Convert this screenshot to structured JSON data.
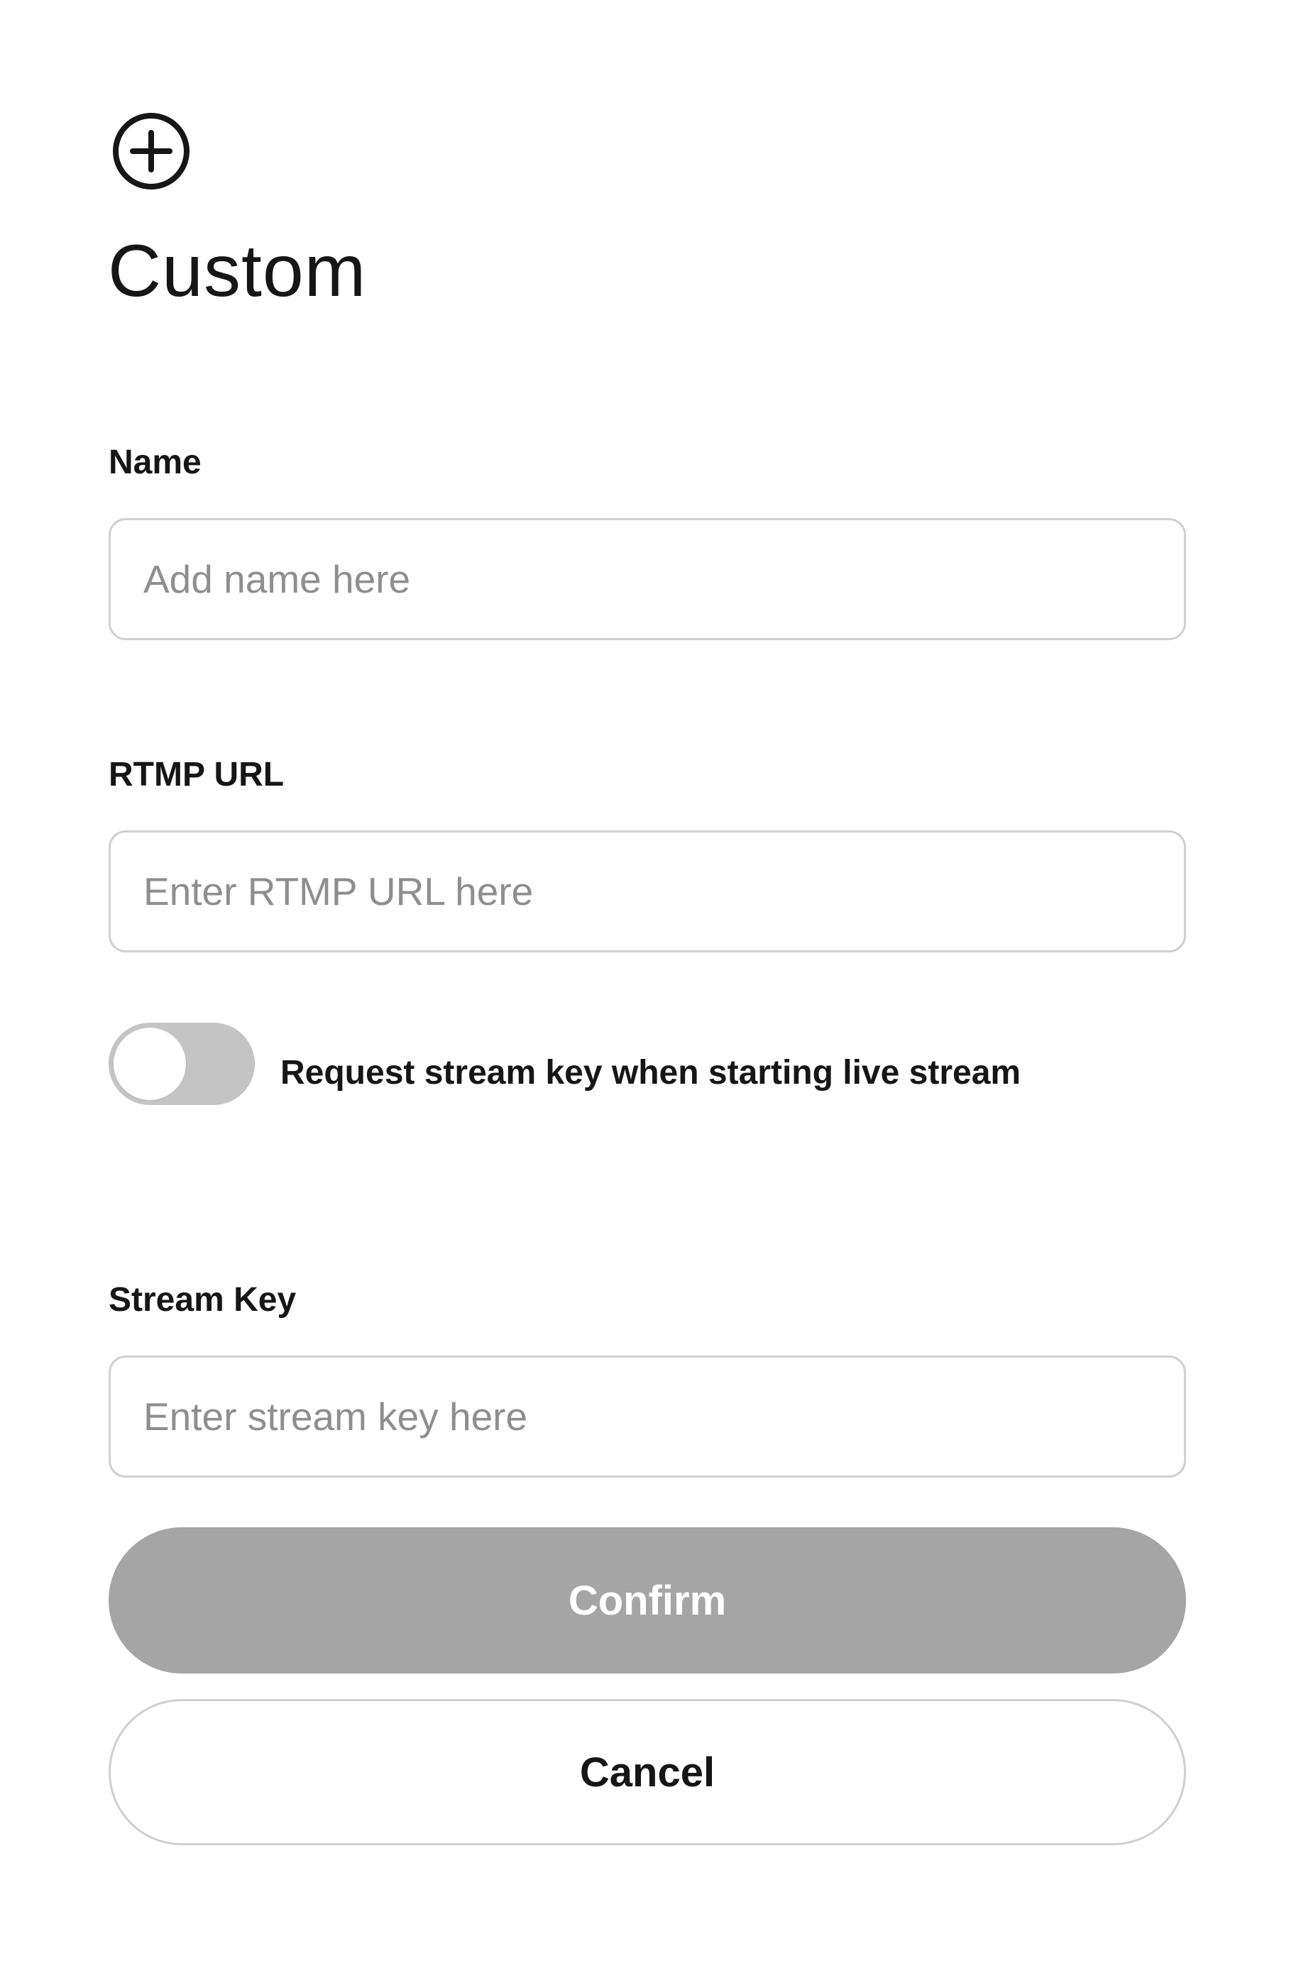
{
  "header": {
    "icon": "plus-circle-icon",
    "title": "Custom"
  },
  "form": {
    "name": {
      "label": "Name",
      "value": "",
      "placeholder": "Add name here"
    },
    "rtmp_url": {
      "label": "RTMP URL",
      "value": "",
      "placeholder": "Enter RTMP URL here"
    },
    "request_key_toggle": {
      "label": "Request stream key when starting live stream",
      "checked": false
    },
    "stream_key": {
      "label": "Stream Key",
      "value": "",
      "placeholder": "Enter stream key here"
    }
  },
  "actions": {
    "confirm_label": "Confirm",
    "cancel_label": "Cancel"
  },
  "colors": {
    "text": "#161616",
    "placeholder": "#8e8e8e",
    "border": "#cfcfcf",
    "toggle_off": "#c4c4c4",
    "confirm_disabled": "#a5a5a5"
  }
}
